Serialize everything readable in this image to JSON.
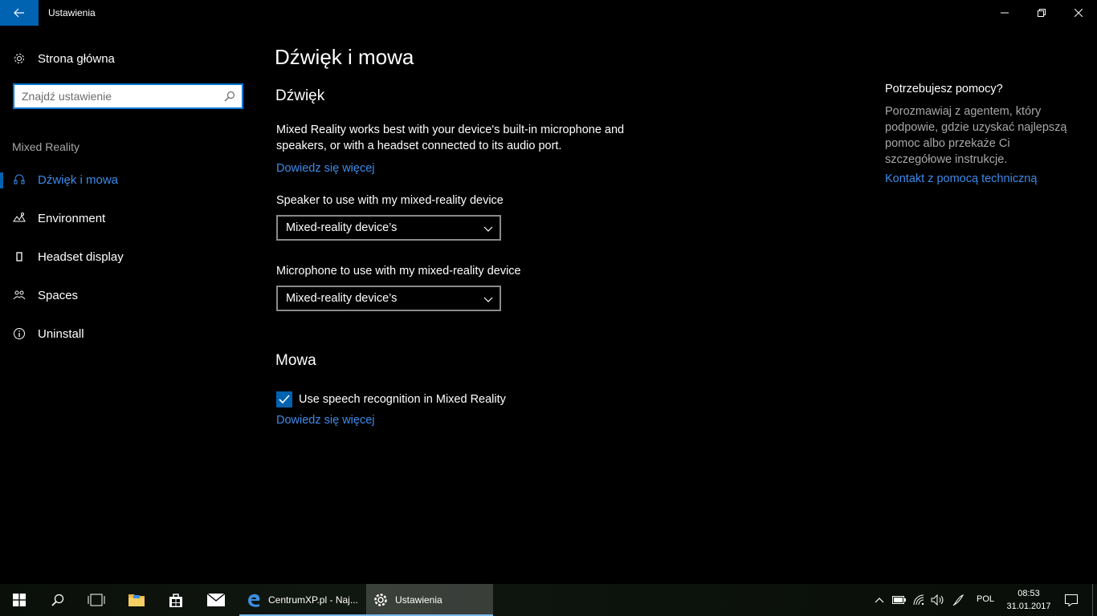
{
  "window": {
    "title": "Ustawienia"
  },
  "sidebar": {
    "home_label": "Strona główna",
    "search_placeholder": "Znajdź ustawienie",
    "group_label": "Mixed Reality",
    "items": [
      {
        "label": "Dźwięk i mowa",
        "icon": "headset-icon",
        "active": true
      },
      {
        "label": "Environment",
        "icon": "environment-icon",
        "active": false
      },
      {
        "label": "Headset display",
        "icon": "display-icon",
        "active": false
      },
      {
        "label": "Spaces",
        "icon": "spaces-icon",
        "active": false
      },
      {
        "label": "Uninstall",
        "icon": "info-icon",
        "active": false
      }
    ]
  },
  "main": {
    "title": "Dźwięk i mowa",
    "sound_section": {
      "title": "Dźwięk",
      "description": "Mixed Reality works best with your device's built-in microphone and speakers, or with a headset connected to its audio port.",
      "learn_more": "Dowiedz się więcej",
      "speaker_label": "Speaker to use with my mixed-reality device",
      "speaker_value": "Mixed-reality device’s",
      "microphone_label": "Microphone to use with my mixed-reality device",
      "microphone_value": "Mixed-reality device’s"
    },
    "speech_section": {
      "title": "Mowa",
      "checkbox_label": "Use speech recognition in Mixed Reality",
      "checkbox_checked": true,
      "learn_more": "Dowiedz się więcej"
    }
  },
  "help": {
    "title": "Potrzebujesz pomocy?",
    "description": "Porozmawiaj z agentem, który podpowie, gdzie uzyskać najlepszą pomoc albo przekaże Ci szczegółowe instrukcje.",
    "link": "Kontakt z pomocą techniczną"
  },
  "taskbar": {
    "apps": [
      {
        "label": "CentrumXP.pl - Naj...",
        "icon": "edge-icon",
        "active": false
      },
      {
        "label": "Ustawienia",
        "icon": "gear-icon",
        "active": true
      }
    ],
    "language": "POL",
    "time": "08:53",
    "date": "31.01.2017"
  },
  "colors": {
    "accent": "#0063b1",
    "link": "#3d8bea",
    "background": "#000000",
    "secondary_text": "#a8a8a8"
  }
}
